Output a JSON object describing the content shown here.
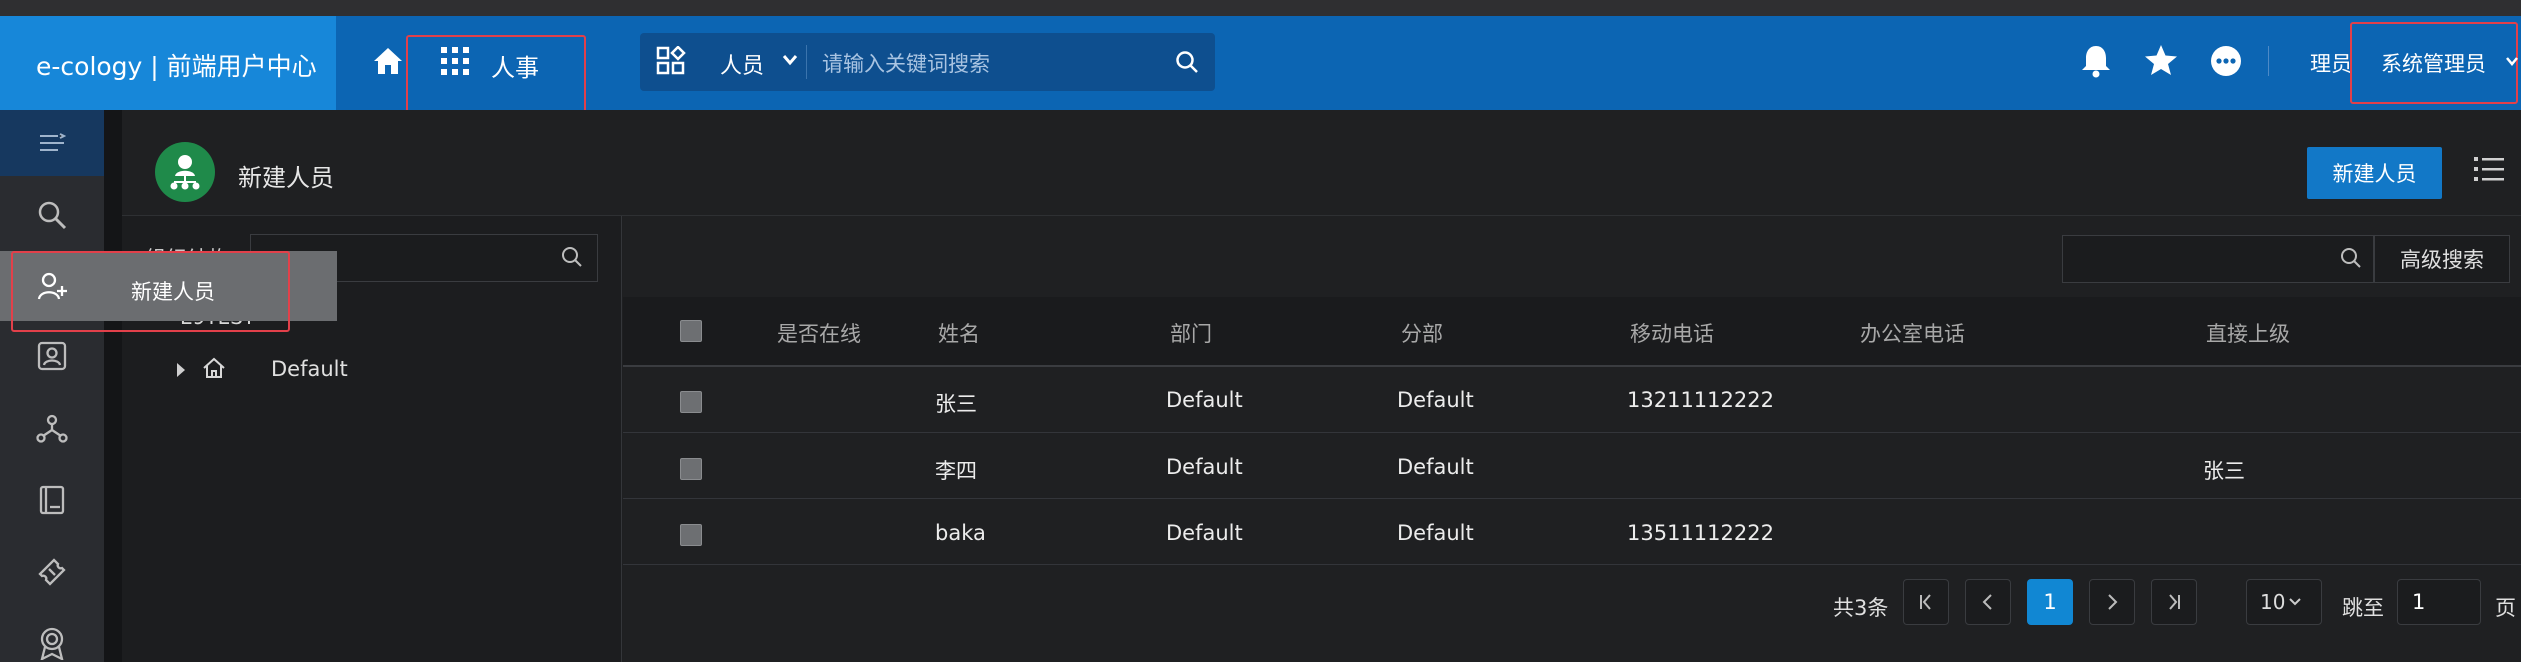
{
  "topbar": {
    "brand": "e-cology | 前端用户中心",
    "module_label": "人事",
    "search_type": "人员",
    "search_placeholder": "请输入关键词搜索",
    "user_partial": "理员",
    "user_name": "系统管理员"
  },
  "page": {
    "title": "新建人员",
    "new_button": "新建人员"
  },
  "tree": {
    "label": "组织结构",
    "root": "E9TEST",
    "child": "Default"
  },
  "popup": {
    "label": "新建人员"
  },
  "grid": {
    "advanced_search": "高级搜索",
    "columns": [
      "是否在线",
      "姓名",
      "部门",
      "分部",
      "移动电话",
      "办公室电话",
      "直接上级"
    ],
    "rows": [
      {
        "online": "",
        "name": "张三",
        "dept": "Default",
        "sub": "Default",
        "mobile": "13211112222",
        "office": "",
        "manager": ""
      },
      {
        "online": "",
        "name": "李四",
        "dept": "Default",
        "sub": "Default",
        "mobile": "",
        "office": "",
        "manager": "张三"
      },
      {
        "online": "",
        "name": "baka",
        "dept": "Default",
        "sub": "Default",
        "mobile": "13511112222",
        "office": "",
        "manager": ""
      }
    ]
  },
  "pagination": {
    "total": "共3条",
    "current": "1",
    "page_size": "10",
    "jump_label": "跳至",
    "jump_value": "1",
    "page_label": "页"
  }
}
